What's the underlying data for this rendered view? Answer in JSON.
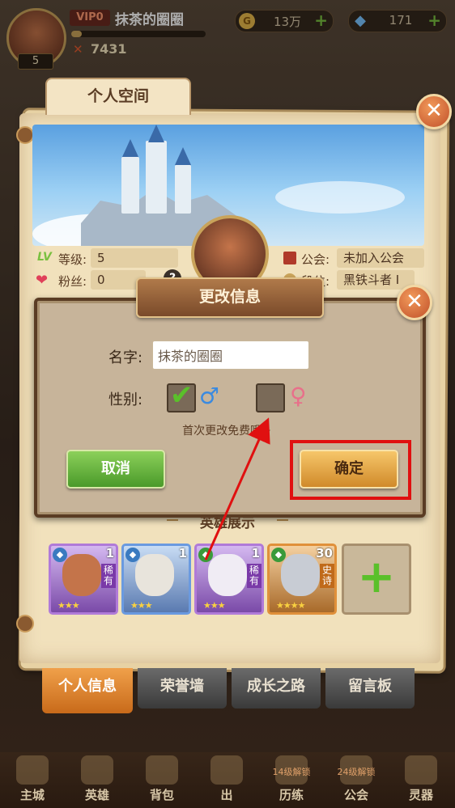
{
  "hud": {
    "vip": "VIP0",
    "player_name": "抹茶的圈圈",
    "avatar_level": "5",
    "power": "7431",
    "xp_progress": 0.08,
    "coins": "13万",
    "gems": "171"
  },
  "panel": {
    "title": "个人空间",
    "level_label": "等级:",
    "level_value": "5",
    "fans_label": "粉丝:",
    "fans_value": "0",
    "guild_label": "公会:",
    "guild_value": "未加入公会",
    "rank_label": "段位:",
    "rank_value": "黑铁斗者 I"
  },
  "dialog": {
    "title": "更改信息",
    "name_label": "名字:",
    "name_value": "抹茶的圈圈",
    "gender_label": "性别:",
    "male_checked": true,
    "female_checked": false,
    "free_hint": "首次更改免费哦~",
    "cancel_label": "取消",
    "confirm_label": "确定"
  },
  "heroes": {
    "title": "英雄展示",
    "cards": [
      {
        "level": "1",
        "tag": "稀有",
        "stars": "★★★",
        "frame": "purple"
      },
      {
        "level": "1",
        "tag": "",
        "stars": "★★★",
        "frame": "blue"
      },
      {
        "level": "1",
        "tag": "稀有",
        "stars": "★★★",
        "frame": "purple"
      },
      {
        "level": "30",
        "tag": "史诗",
        "stars": "★★★★",
        "frame": "orange"
      }
    ]
  },
  "tabs": [
    "个人信息",
    "荣誉墙",
    "成长之路",
    "留言板"
  ],
  "nav": [
    {
      "label": "主城",
      "lock": ""
    },
    {
      "label": "英雄",
      "lock": ""
    },
    {
      "label": "背包",
      "lock": ""
    },
    {
      "label": "出",
      "lock": ""
    },
    {
      "label": "历练",
      "lock": "14级解锁"
    },
    {
      "label": "公会",
      "lock": "24级解锁"
    },
    {
      "label": "灵器",
      "lock": ""
    }
  ],
  "colors": {
    "highlight": "#e01010",
    "confirm": "#e8a63a",
    "cancel": "#6ab83a"
  }
}
